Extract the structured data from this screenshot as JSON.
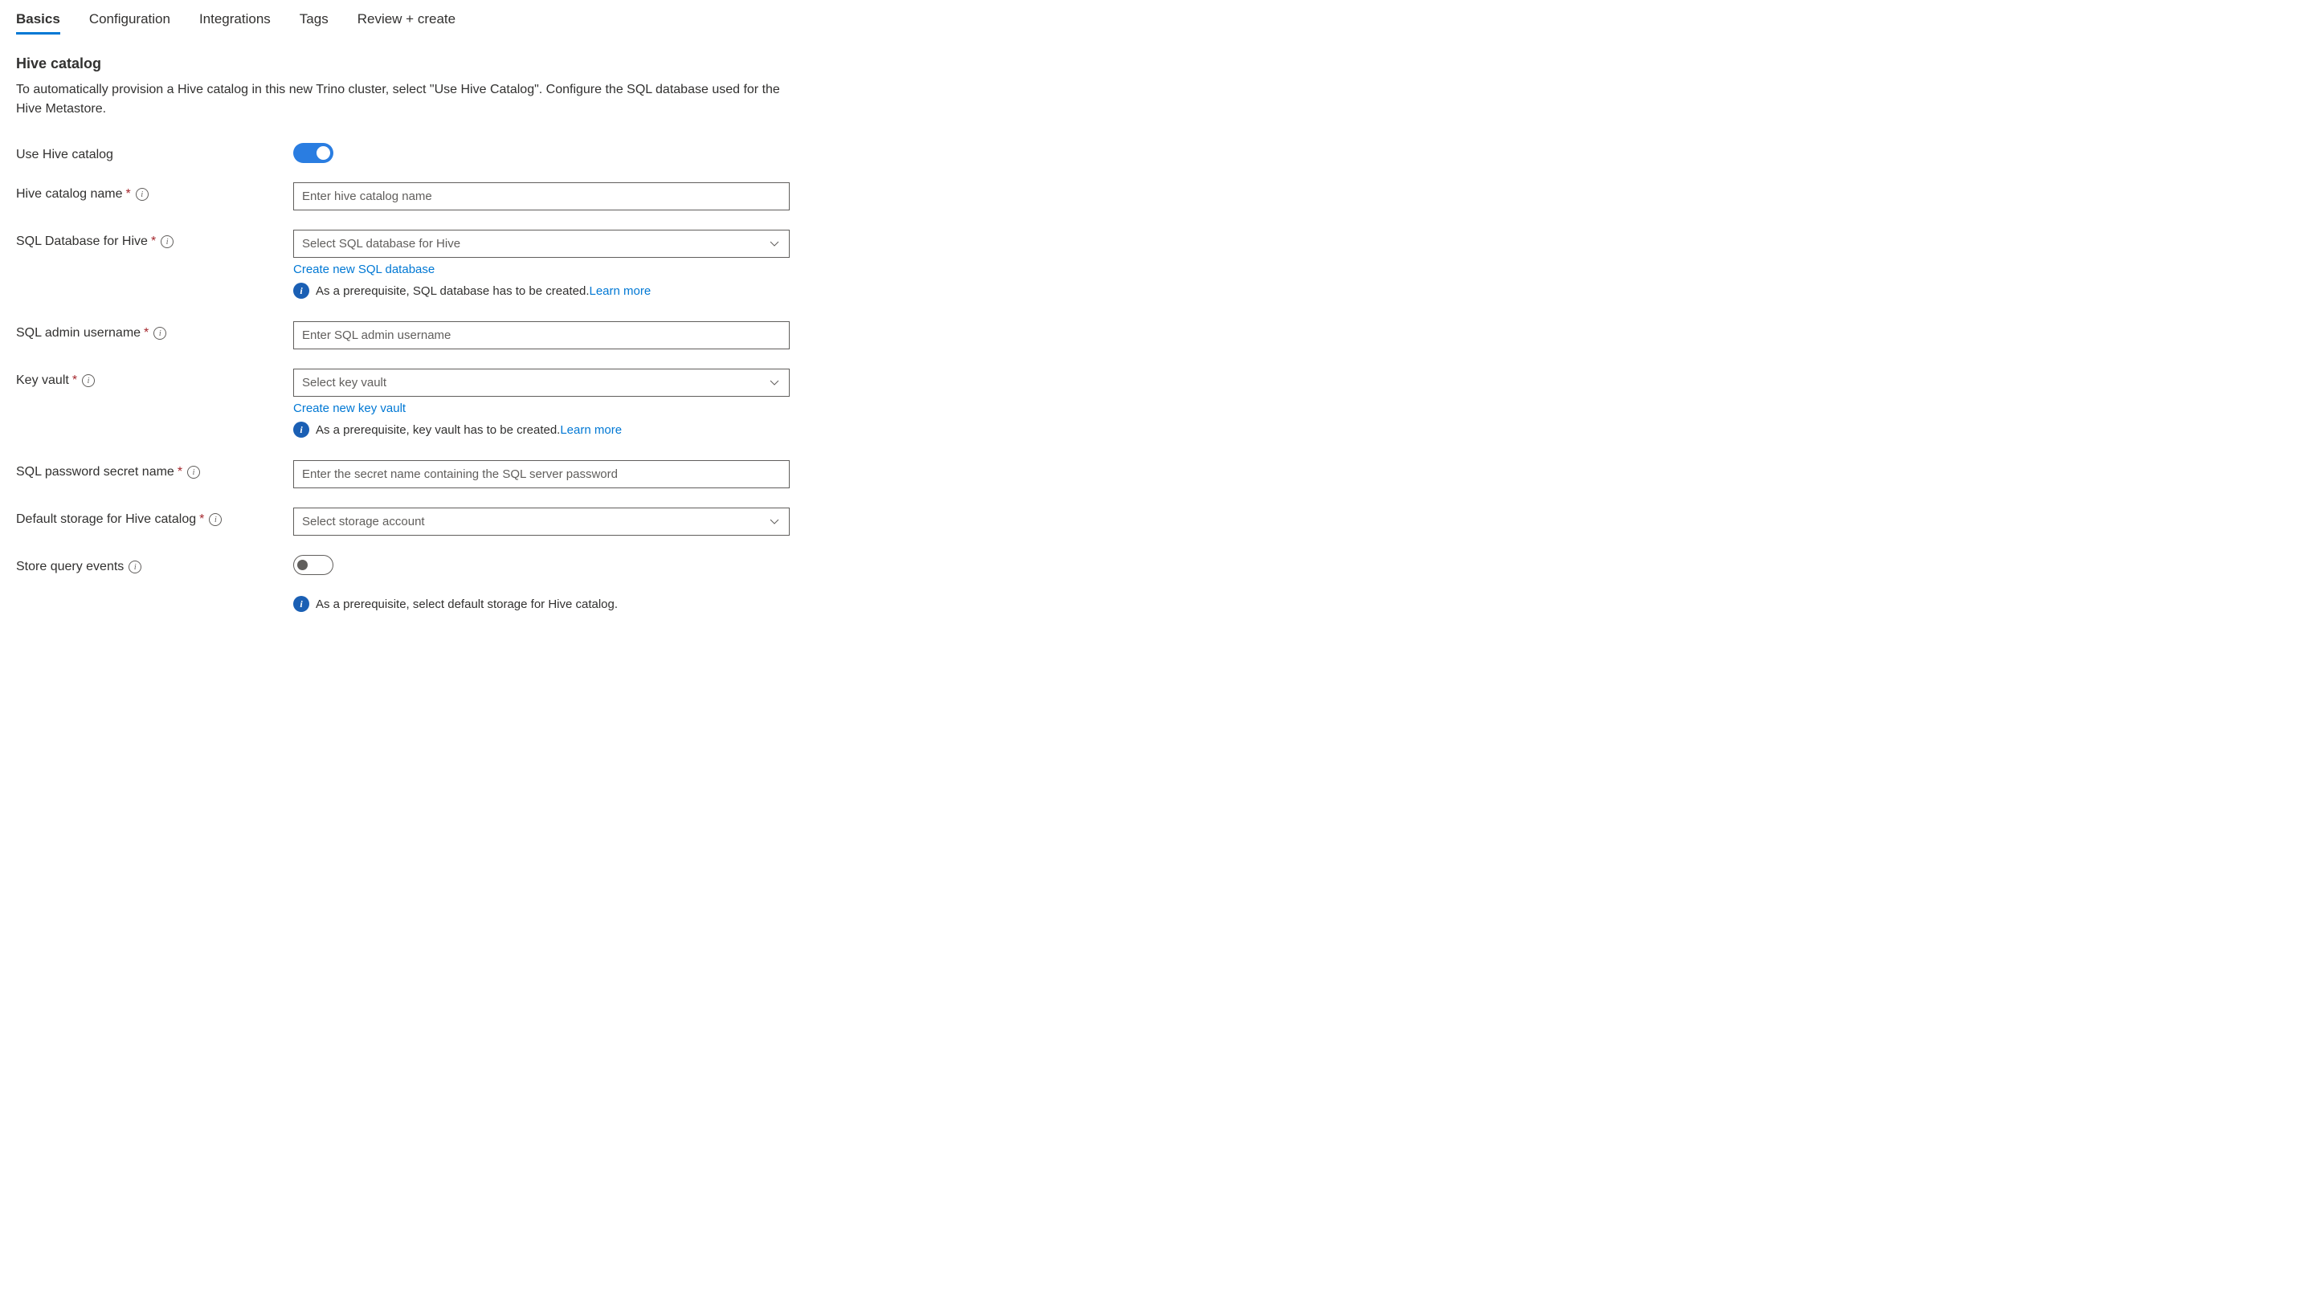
{
  "tabs": [
    {
      "label": "Basics",
      "active": true
    },
    {
      "label": "Configuration",
      "active": false
    },
    {
      "label": "Integrations",
      "active": false
    },
    {
      "label": "Tags",
      "active": false
    },
    {
      "label": "Review + create",
      "active": false
    }
  ],
  "section": {
    "title": "Hive catalog",
    "description": "To automatically provision a Hive catalog in this new Trino cluster, select \"Use Hive Catalog\". Configure the SQL database used for the Hive Metastore."
  },
  "fields": {
    "useHiveCatalog": {
      "label": "Use Hive catalog",
      "value": true
    },
    "hiveCatalogName": {
      "label": "Hive catalog name",
      "placeholder": "Enter hive catalog name",
      "required": true
    },
    "sqlDatabase": {
      "label": "SQL Database for Hive",
      "placeholder": "Select SQL database for Hive",
      "required": true,
      "createLink": "Create new SQL database",
      "prereqText": "As a prerequisite, SQL database has to be created.",
      "learnMore": "Learn more"
    },
    "sqlAdminUsername": {
      "label": "SQL admin username",
      "placeholder": "Enter SQL admin username",
      "required": true
    },
    "keyVault": {
      "label": "Key vault",
      "placeholder": "Select key vault",
      "required": true,
      "createLink": "Create new key vault",
      "prereqText": "As a prerequisite, key vault has to be created.",
      "learnMore": "Learn more"
    },
    "sqlPasswordSecret": {
      "label": "SQL password secret name",
      "placeholder": "Enter the secret name containing the SQL server password",
      "required": true
    },
    "defaultStorage": {
      "label": "Default storage for Hive catalog",
      "placeholder": "Select storage account",
      "required": true
    },
    "storeQueryEvents": {
      "label": "Store query events",
      "value": false,
      "prereqText": "As a prerequisite, select default storage for Hive catalog."
    }
  }
}
